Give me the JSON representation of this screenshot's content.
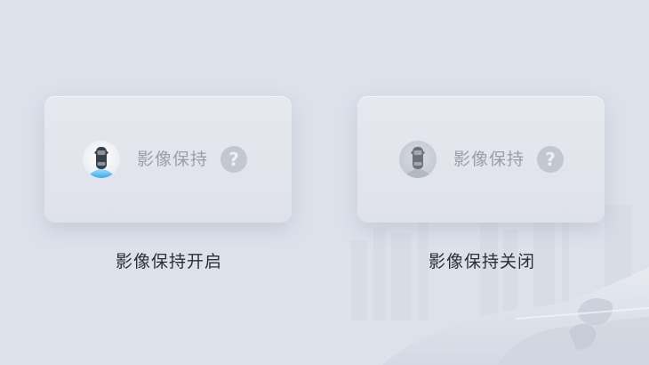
{
  "options": [
    {
      "label": "影像保持",
      "caption": "影像保持开启",
      "help_glyph": "?",
      "icon": "car-top-view-camera-on-icon",
      "accent": "#4fb3e8"
    },
    {
      "label": "影像保持",
      "caption": "影像保持关闭",
      "help_glyph": "?",
      "icon": "car-top-view-camera-off-icon",
      "accent": "#8a8e98"
    }
  ]
}
